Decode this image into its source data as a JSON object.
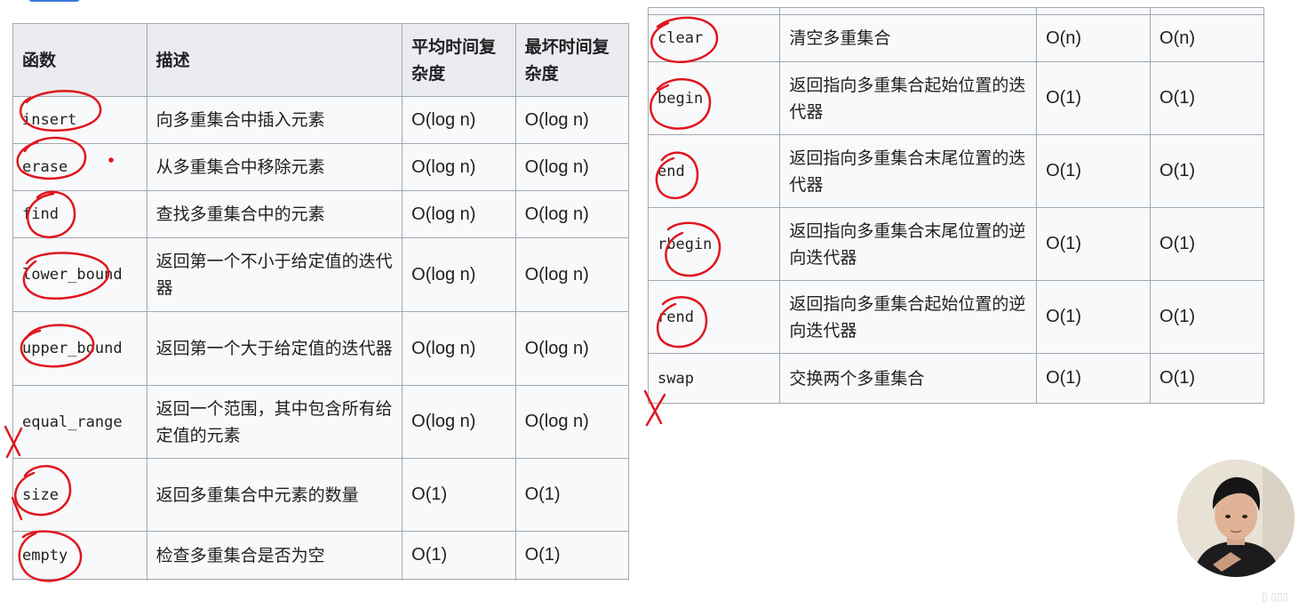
{
  "left_table": {
    "headers": [
      "函数",
      "描述",
      "平均时间复杂度",
      "最坏时间复杂度"
    ],
    "rows": [
      {
        "fn": "insert",
        "desc": "向多重集合中插入元素",
        "avg": "O(log n)",
        "worst": "O(log n)"
      },
      {
        "fn": "erase",
        "desc": "从多重集合中移除元素",
        "avg": "O(log n)",
        "worst": "O(log n)"
      },
      {
        "fn": "find",
        "desc": "查找多重集合中的元素",
        "avg": "O(log n)",
        "worst": "O(log n)"
      },
      {
        "fn": "lower_bound",
        "desc": "返回第一个不小于给定值的迭代器",
        "avg": "O(log n)",
        "worst": "O(log n)"
      },
      {
        "fn": "upper_bound",
        "desc": "返回第一个大于给定值的迭代器",
        "avg": "O(log n)",
        "worst": "O(log n)"
      },
      {
        "fn": "equal_range",
        "desc": "返回一个范围，其中包含所有给定值的元素",
        "avg": "O(log n)",
        "worst": "O(log n)"
      },
      {
        "fn": "size",
        "desc": "返回多重集合中元素的数量",
        "avg": "O(1)",
        "worst": "O(1)"
      },
      {
        "fn": "empty",
        "desc": "检查多重集合是否为空",
        "avg": "O(1)",
        "worst": "O(1)"
      }
    ]
  },
  "right_table": {
    "rows": [
      {
        "fn": "clear",
        "desc": "清空多重集合",
        "avg": "O(n)",
        "worst": "O(n)"
      },
      {
        "fn": "begin",
        "desc": "返回指向多重集合起始位置的迭代器",
        "avg": "O(1)",
        "worst": "O(1)"
      },
      {
        "fn": "end",
        "desc": "返回指向多重集合末尾位置的迭代器",
        "avg": "O(1)",
        "worst": "O(1)"
      },
      {
        "fn": "rbegin",
        "desc": "返回指向多重集合末尾位置的逆向迭代器",
        "avg": "O(1)",
        "worst": "O(1)"
      },
      {
        "fn": "rend",
        "desc": "返回指向多重集合起始位置的逆向迭代器",
        "avg": "O(1)",
        "worst": "O(1)"
      },
      {
        "fn": "swap",
        "desc": "交换两个多重集合",
        "avg": "O(1)",
        "worst": "O(1)"
      }
    ]
  },
  "colors": {
    "annotation_red": "#e0161e",
    "border": "#a2a9b1",
    "cell_bg": "#f8f9fa",
    "header_bg": "#eaecf0"
  }
}
